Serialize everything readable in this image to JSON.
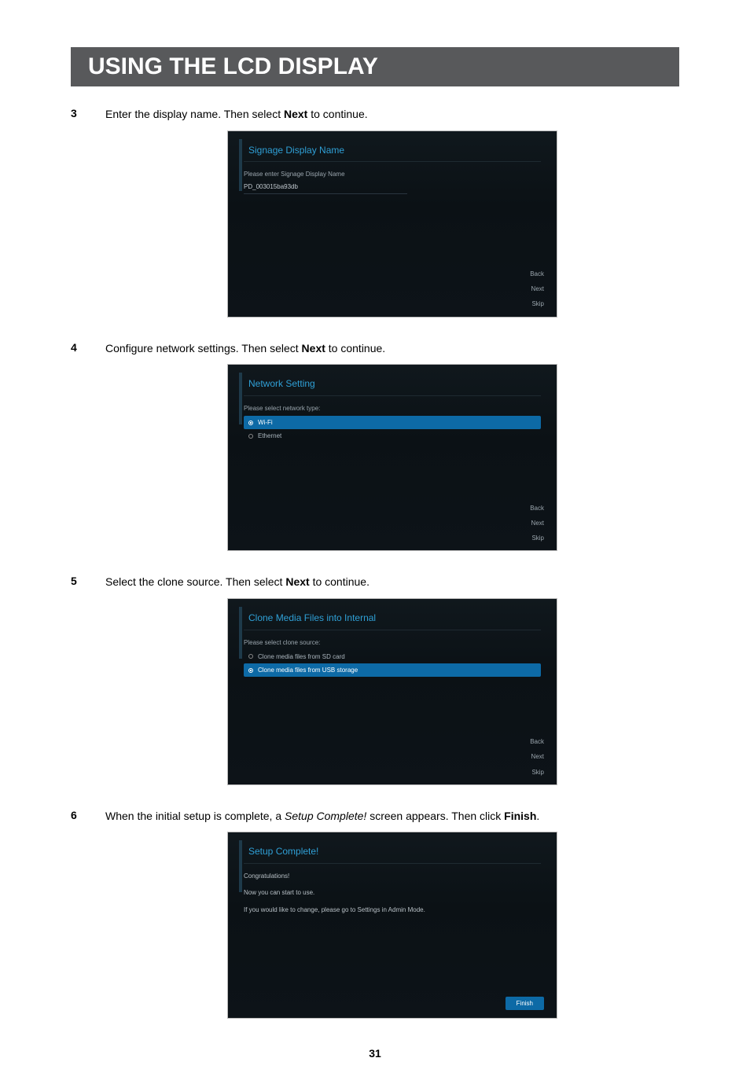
{
  "header": {
    "title": "USING THE LCD DISPLAY"
  },
  "steps": [
    {
      "num": "3",
      "desc_parts": [
        "Enter the display name. Then select ",
        {
          "b": "Next"
        },
        " to continue."
      ],
      "panel": {
        "title": "Signage Display Name",
        "label": "Please enter Signage Display Name",
        "input_value": "PD_003015ba93db",
        "buttons": [
          "Back",
          "Next",
          "Skip"
        ]
      }
    },
    {
      "num": "4",
      "desc_parts": [
        "Configure network settings. Then select ",
        {
          "b": "Next"
        },
        " to continue."
      ],
      "panel": {
        "title": "Network Setting",
        "label": "Please select network type:",
        "options": [
          {
            "label": "Wi-Fi",
            "selected": true
          },
          {
            "label": "Ethernet",
            "selected": false
          }
        ],
        "buttons": [
          "Back",
          "Next",
          "Skip"
        ]
      }
    },
    {
      "num": "5",
      "desc_parts": [
        "Select the clone source. Then select ",
        {
          "b": "Next"
        },
        " to continue."
      ],
      "panel": {
        "title": "Clone Media Files into Internal",
        "label": "Please select clone source:",
        "options": [
          {
            "label": "Clone media files from SD card",
            "selected": false
          },
          {
            "label": "Clone media files from USB storage",
            "selected": true
          }
        ],
        "buttons": [
          "Back",
          "Next",
          "Skip"
        ]
      }
    },
    {
      "num": "6",
      "desc_parts": [
        "When the initial setup is complete, a ",
        {
          "i": "Setup Complete!"
        },
        " screen appears. Then click ",
        {
          "b": "Finish"
        },
        "."
      ],
      "panel": {
        "title": "Setup Complete!",
        "lines": [
          "Congratulations!",
          "Now you can start to use.",
          "If you would like to change, please go to Settings in Admin Mode."
        ],
        "finish": "Finish"
      }
    }
  ],
  "page_number": "31"
}
